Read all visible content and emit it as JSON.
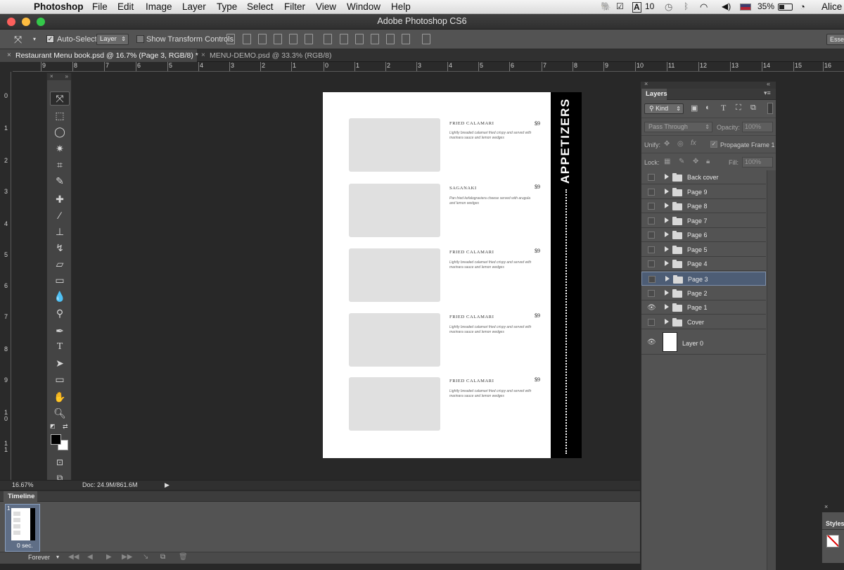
{
  "menubar": {
    "app_name": "Photoshop",
    "items": [
      "File",
      "Edit",
      "Image",
      "Layer",
      "Type",
      "Select",
      "Filter",
      "View",
      "Window",
      "Help"
    ],
    "status": {
      "user": "Alice",
      "battery": "35%",
      "count": "10"
    }
  },
  "window": {
    "title": "Adobe Photoshop CS6"
  },
  "options_bar": {
    "auto_select_label": "Auto-Select:",
    "auto_select_value": "Layer",
    "transform_label": "Show Transform Controls",
    "workspace_label": "Esse"
  },
  "tabs": [
    {
      "label": "Restaurant Menu book.psd @ 16.7% (Page 3, RGB/8) *",
      "active": true
    },
    {
      "label": "MENU-DEMO.psd @ 33.3% (RGB/8)",
      "active": false
    }
  ],
  "rulers": {
    "h": [
      "9",
      "8",
      "7",
      "6",
      "5",
      "4",
      "3",
      "2",
      "1",
      "0",
      "1",
      "2",
      "3",
      "4",
      "5",
      "6",
      "7",
      "8",
      "9",
      "10",
      "11",
      "12",
      "13",
      "14",
      "15",
      "16"
    ],
    "v": [
      "0",
      "1",
      "2",
      "3",
      "4",
      "5",
      "6",
      "7",
      "8",
      "9",
      "1 0",
      "1 1"
    ]
  },
  "document": {
    "section_title": "APPETIZERS",
    "items": [
      {
        "name": "FRIED CALAMARI",
        "price": "$9",
        "description": "Lightly breaded calamari fried crispy and served with marinara sauce and lemon wedges"
      },
      {
        "name": "SAGANAKI",
        "price": "$9",
        "description": "Pan fried kefalograviera cheese served with arugula and lemon wedges"
      },
      {
        "name": "FRIED CALAMARI",
        "price": "$9",
        "description": "Lightly breaded calamari fried crispy and served with marinara sauce and lemon wedges"
      },
      {
        "name": "FRIED CALAMARI",
        "price": "$9",
        "description": "Lightly breaded calamari fried crispy and served with marinara sauce and lemon wedges"
      },
      {
        "name": "FRIED CALAMARI",
        "price": "$9",
        "description": "Lightly breaded calamari fried crispy and served with marinara sauce and lemon wedges"
      }
    ]
  },
  "status_bar": {
    "zoom": "16.67%",
    "doc_info": "Doc: 24.9M/861.6M"
  },
  "timeline": {
    "title": "Timeline",
    "frame_number": "1",
    "frame_delay": "0 sec.",
    "loop": "Forever"
  },
  "layers_panel": {
    "title": "Layers",
    "filter_kind": "Kind",
    "blend_mode": "Pass Through",
    "opacity_label": "Opacity:",
    "opacity_value": "100%",
    "unify_label": "Unify:",
    "propagate_label": "Propagate Frame 1",
    "lock_label": "Lock:",
    "fill_label": "Fill:",
    "fill_value": "100%",
    "layers": [
      {
        "name": "Back cover",
        "visible": false,
        "selected": false
      },
      {
        "name": "Page 9",
        "visible": false,
        "selected": false
      },
      {
        "name": "Page 8",
        "visible": false,
        "selected": false
      },
      {
        "name": "Page 7",
        "visible": false,
        "selected": false
      },
      {
        "name": "Page 6",
        "visible": false,
        "selected": false
      },
      {
        "name": "Page 5",
        "visible": false,
        "selected": false
      },
      {
        "name": "Page 4",
        "visible": false,
        "selected": false
      },
      {
        "name": "Page 3",
        "visible": false,
        "selected": true
      },
      {
        "name": "Page 2",
        "visible": false,
        "selected": false
      },
      {
        "name": "Page 1",
        "visible": true,
        "selected": false
      },
      {
        "name": "Cover",
        "visible": false,
        "selected": false
      }
    ],
    "base_layer": {
      "name": "Layer 0",
      "visible": true
    }
  },
  "styles_panel": {
    "title": "Styles"
  },
  "colors": {
    "accent_selected": "#4d5d75",
    "close_red": "#fc605c",
    "min_yellow": "#fdbc40",
    "max_green": "#34c84a"
  }
}
